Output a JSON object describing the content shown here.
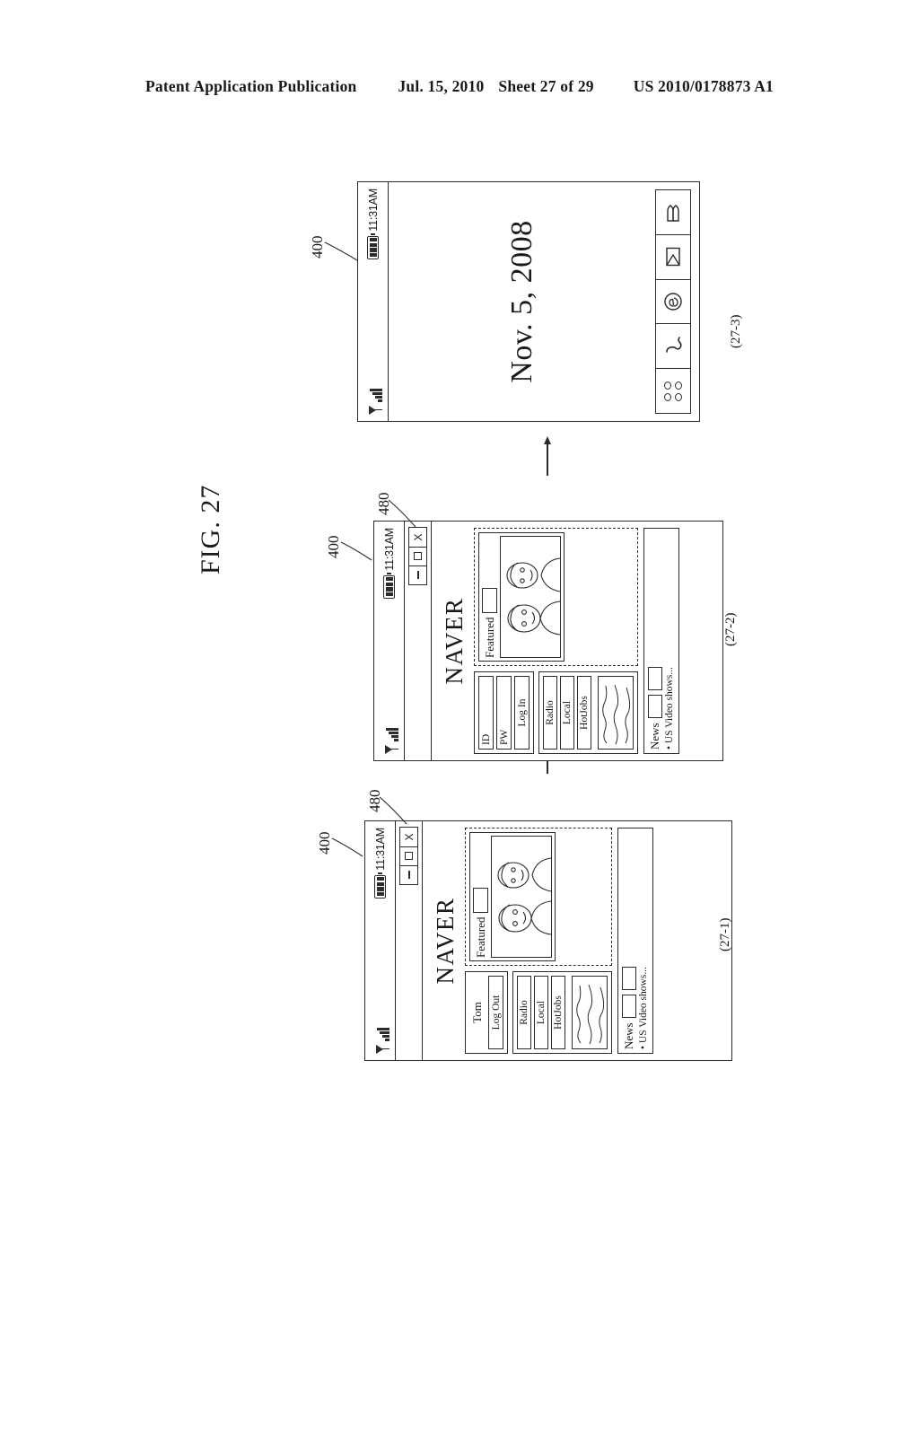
{
  "header": {
    "publication": "Patent Application Publication",
    "date": "Jul. 15, 2010",
    "sheet": "Sheet 27 of 29",
    "patent_number": "US 2010/0178873 A1"
  },
  "figure": {
    "label": "FIG. 27"
  },
  "reference_numerals": {
    "device": "400",
    "browser_window": "480"
  },
  "status_bar": {
    "time": "11:31AM",
    "signal_icon": "antenna-signal-icon",
    "battery_icon": "battery-icon"
  },
  "window_controls": {
    "close": "X",
    "maximize": "□",
    "minimize": "–"
  },
  "panels": [
    {
      "caption": "(27-1)",
      "type": "browser",
      "brand": "NAVER",
      "account": {
        "state": "logged-in",
        "user_name": "Tom",
        "action_label": "Log Out"
      },
      "nav_items": [
        "Radio",
        "Local",
        "HotJobs"
      ],
      "featured": {
        "label": "Featured"
      },
      "news": {
        "label": "News",
        "items": [
          "• US Video shows..."
        ]
      }
    },
    {
      "caption": "(27-2)",
      "type": "browser",
      "brand": "NAVER",
      "account": {
        "state": "logged-out",
        "id_label": "ID",
        "pw_label": "PW",
        "action_label": "Log In"
      },
      "nav_items": [
        "Radio",
        "Local",
        "HotJobs"
      ],
      "featured": {
        "label": "Featured"
      },
      "news": {
        "label": "News",
        "items": [
          "• US Video shows..."
        ]
      }
    },
    {
      "caption": "(27-3)",
      "type": "idle",
      "date_display": "Nov. 5, 2008",
      "dock_icons": [
        "menu-grid-icon",
        "phone-handset-icon",
        "browser-e-icon",
        "envelope-message-icon",
        "flag-bookmark-icon"
      ]
    }
  ],
  "colors": {
    "ink": "#2b2b2b",
    "paper": "#ffffff"
  }
}
